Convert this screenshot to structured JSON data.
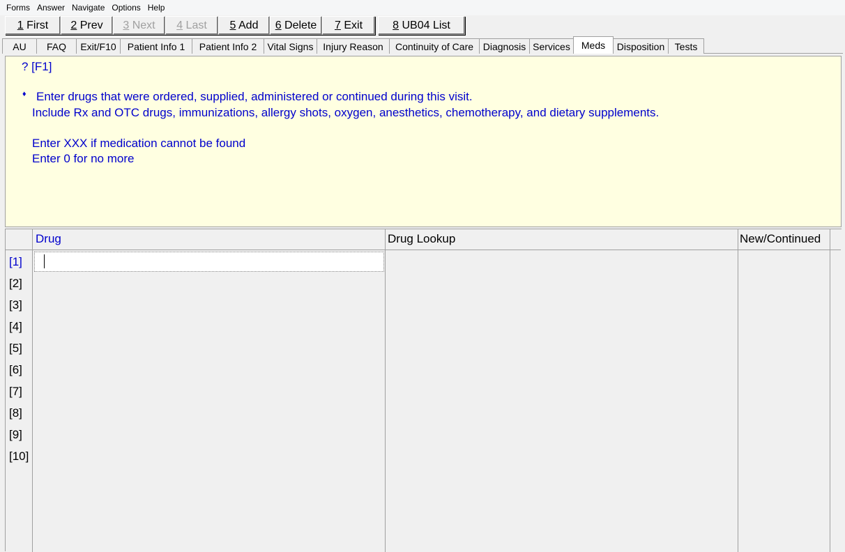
{
  "menu": [
    "Forms",
    "Answer",
    "Navigate",
    "Options",
    "Help"
  ],
  "toolbar": [
    {
      "hot": "1",
      "label": " First",
      "enabled": true
    },
    {
      "hot": "2",
      "label": " Prev",
      "enabled": true
    },
    {
      "hot": "3",
      "label": " Next",
      "enabled": false
    },
    {
      "hot": "4",
      "label": " Last",
      "enabled": false
    },
    {
      "hot": "5",
      "label": " Add",
      "enabled": true
    },
    {
      "hot": "6",
      "label": " Delete",
      "enabled": true
    },
    {
      "hot": "7",
      "label": " Exit",
      "enabled": true
    },
    {
      "hot": "8",
      "label": " UB04 List",
      "enabled": true
    }
  ],
  "tabs": [
    "AU",
    "FAQ",
    "Exit/F10",
    "Patient Info 1",
    "Patient Info 2",
    "Vital Signs",
    "Injury Reason",
    "Continuity of Care",
    "Diagnosis",
    "Services",
    "Meds",
    "Disposition",
    "Tests"
  ],
  "active_tab": "Meds",
  "help": {
    "question": "? [F1]",
    "bullet": "♦",
    "line1": "Enter drugs that were ordered, supplied, administered or continued during this visit.",
    "line2": "Include Rx and OTC drugs, immunizations, allergy shots, oxygen, anesthetics, chemotherapy, and dietary supplements.",
    "line3": "Enter XXX if medication cannot be found",
    "line4": "Enter 0 for no more"
  },
  "grid": {
    "col_drug": "Drug",
    "col_lookup": "Drug Lookup",
    "col_new": "New/Continued",
    "rows": [
      "[1]",
      "[2]",
      "[3]",
      "[4]",
      "[5]",
      "[6]",
      "[7]",
      "[8]",
      "[9]",
      "[10]"
    ],
    "drug_value": ""
  },
  "colors": {
    "help_bg": "#ffffe1",
    "help_text": "#0000cc"
  }
}
